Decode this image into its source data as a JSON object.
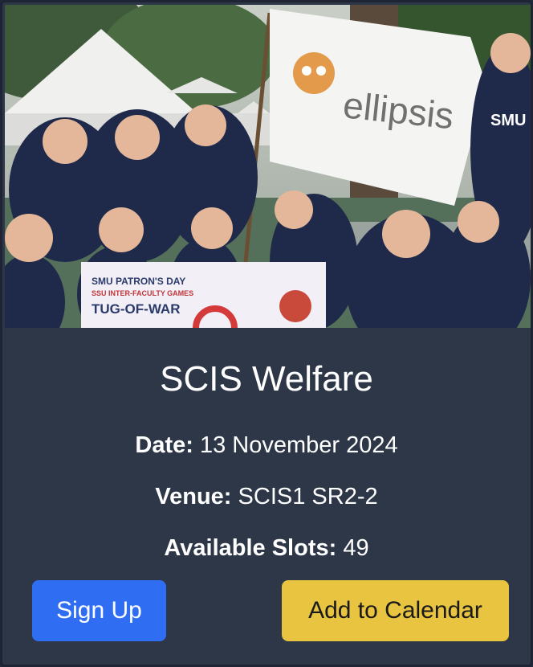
{
  "event": {
    "title": "SCIS Welfare",
    "date_label": "Date:",
    "date_value": "13 November 2024",
    "venue_label": "Venue:",
    "venue_value": "SCIS1 SR2-2",
    "slots_label": "Available Slots:",
    "slots_value": "49"
  },
  "photo": {
    "flag_text": "ellipsis",
    "banner_line1": "SMU PATRON'S DAY",
    "banner_line2": "SSU INTER-FACULTY GAMES",
    "banner_line3": "TUG-OF-WAR",
    "shirt_text": "SMU"
  },
  "actions": {
    "signup_label": "Sign Up",
    "calendar_label": "Add to Calendar"
  },
  "colors": {
    "card_bg": "#2d3748",
    "signup_bg": "#2f6ef3",
    "calendar_bg": "#e8c440"
  }
}
